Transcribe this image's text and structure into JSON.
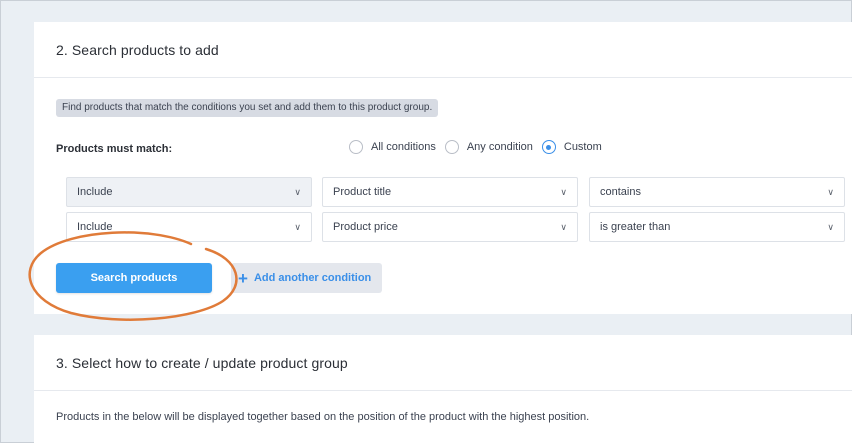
{
  "section2": {
    "title": "2. Search products to add",
    "info_tag": "Find products that match the conditions you set and add them to this product group.",
    "match_label": "Products must match:",
    "radio_options": [
      {
        "label": "All conditions",
        "checked": false
      },
      {
        "label": "Any condition",
        "checked": false
      },
      {
        "label": "Custom",
        "checked": true
      }
    ],
    "conditions": [
      {
        "mode": "Include",
        "field": "Product title",
        "operator": "contains"
      },
      {
        "mode": "Include",
        "field": "Product price",
        "operator": "is greater than"
      }
    ],
    "search_button": "Search products",
    "add_condition_button": "Add another condition"
  },
  "section3": {
    "title": "3. Select how to create / update product group",
    "description": "Products in the below will be displayed together based on the position of the product with the highest position."
  },
  "colors": {
    "accent": "#3a9ff0",
    "highlight_circle": "#e07b39",
    "background": "#eaeff4"
  }
}
